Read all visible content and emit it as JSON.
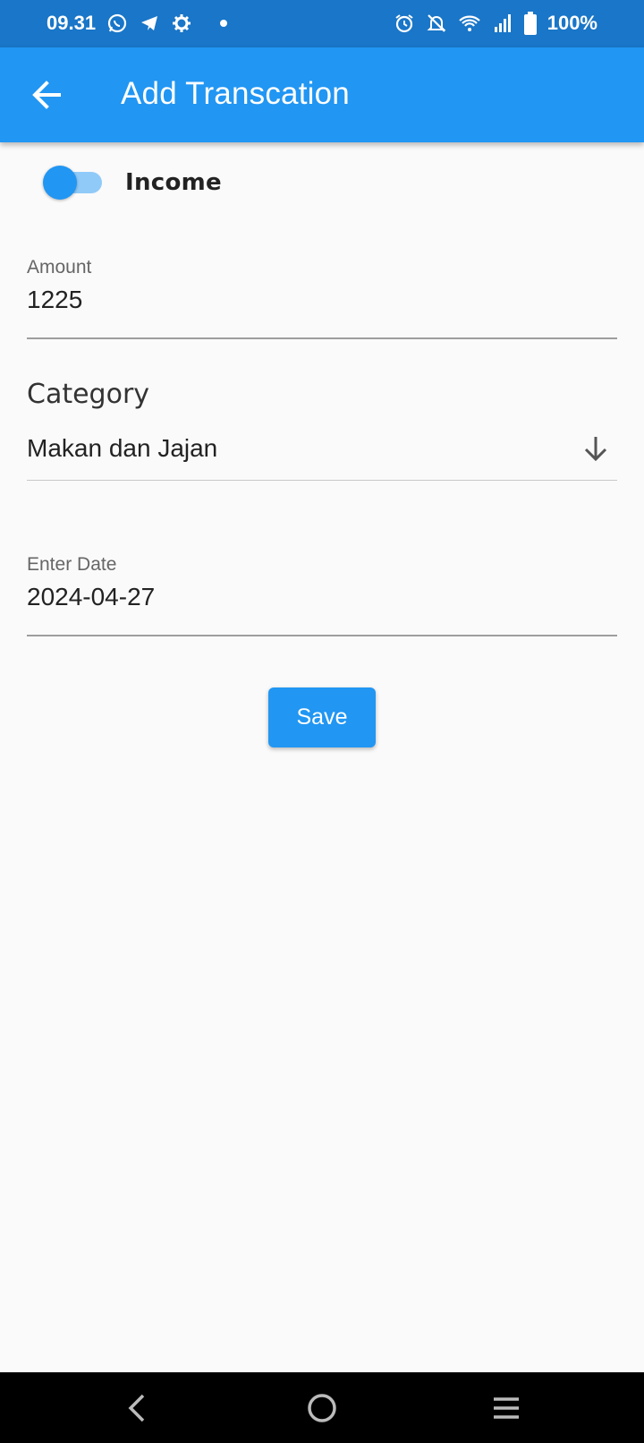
{
  "status_bar": {
    "time": "09.31",
    "battery": "100%",
    "left_icons": [
      "whatsapp-icon",
      "telegram-icon",
      "settings-gear-icon",
      "notification-dot-icon"
    ],
    "right_icons": [
      "alarm-icon",
      "notifications-off-icon",
      "wifi-icon",
      "signal-icon",
      "battery-icon"
    ]
  },
  "app_bar": {
    "title": "Add Transcation",
    "back_icon": "arrow-back-icon"
  },
  "form": {
    "switch": {
      "label": "Income",
      "checked": true
    },
    "amount": {
      "label": "Amount",
      "value": "1225"
    },
    "category": {
      "label": "Category",
      "selected": "Makan dan Jajan",
      "arrow_icon": "arrow-downward-icon"
    },
    "date": {
      "label": "Enter Date",
      "value": "2024-04-27"
    },
    "save_label": "Save"
  },
  "nav_bar": {
    "icons": [
      "nav-back-icon",
      "nav-home-icon",
      "nav-menu-icon"
    ]
  },
  "colors": {
    "primary": "#2196f3",
    "status_bar": "#1976c8",
    "switch_track": "#90caf9",
    "background": "#fafafa"
  }
}
